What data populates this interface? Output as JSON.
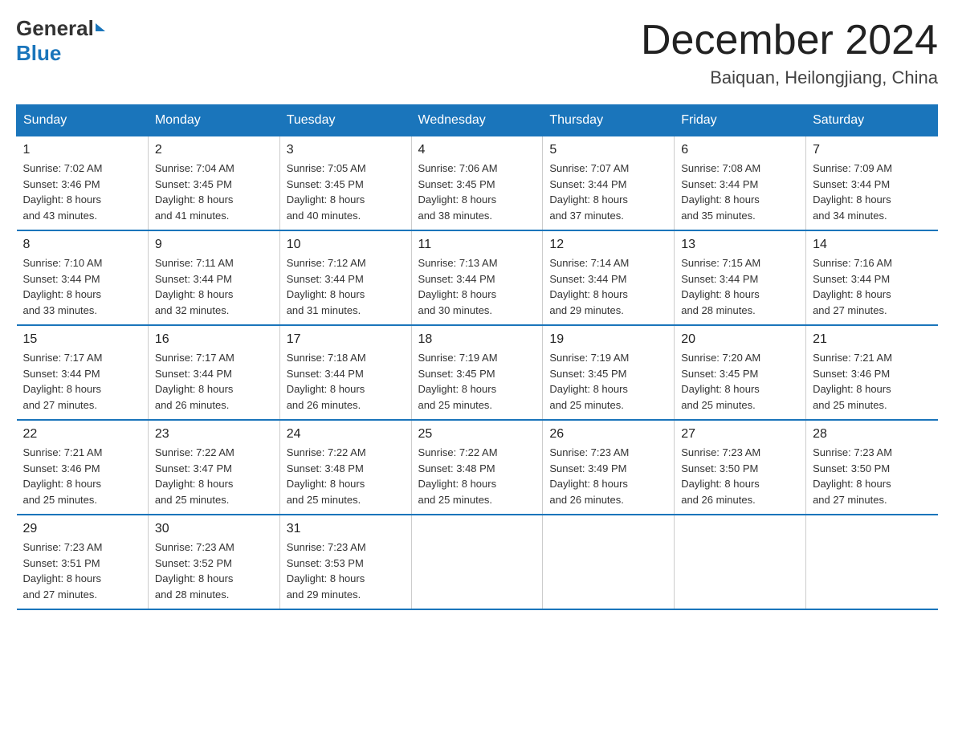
{
  "header": {
    "logo": {
      "general": "General",
      "blue": "Blue"
    },
    "title": "December 2024",
    "location": "Baiquan, Heilongjiang, China"
  },
  "days_of_week": [
    "Sunday",
    "Monday",
    "Tuesday",
    "Wednesday",
    "Thursday",
    "Friday",
    "Saturday"
  ],
  "weeks": [
    [
      {
        "day": "1",
        "sunrise": "7:02 AM",
        "sunset": "3:46 PM",
        "daylight": "8 hours and 43 minutes."
      },
      {
        "day": "2",
        "sunrise": "7:04 AM",
        "sunset": "3:45 PM",
        "daylight": "8 hours and 41 minutes."
      },
      {
        "day": "3",
        "sunrise": "7:05 AM",
        "sunset": "3:45 PM",
        "daylight": "8 hours and 40 minutes."
      },
      {
        "day": "4",
        "sunrise": "7:06 AM",
        "sunset": "3:45 PM",
        "daylight": "8 hours and 38 minutes."
      },
      {
        "day": "5",
        "sunrise": "7:07 AM",
        "sunset": "3:44 PM",
        "daylight": "8 hours and 37 minutes."
      },
      {
        "day": "6",
        "sunrise": "7:08 AM",
        "sunset": "3:44 PM",
        "daylight": "8 hours and 35 minutes."
      },
      {
        "day": "7",
        "sunrise": "7:09 AM",
        "sunset": "3:44 PM",
        "daylight": "8 hours and 34 minutes."
      }
    ],
    [
      {
        "day": "8",
        "sunrise": "7:10 AM",
        "sunset": "3:44 PM",
        "daylight": "8 hours and 33 minutes."
      },
      {
        "day": "9",
        "sunrise": "7:11 AM",
        "sunset": "3:44 PM",
        "daylight": "8 hours and 32 minutes."
      },
      {
        "day": "10",
        "sunrise": "7:12 AM",
        "sunset": "3:44 PM",
        "daylight": "8 hours and 31 minutes."
      },
      {
        "day": "11",
        "sunrise": "7:13 AM",
        "sunset": "3:44 PM",
        "daylight": "8 hours and 30 minutes."
      },
      {
        "day": "12",
        "sunrise": "7:14 AM",
        "sunset": "3:44 PM",
        "daylight": "8 hours and 29 minutes."
      },
      {
        "day": "13",
        "sunrise": "7:15 AM",
        "sunset": "3:44 PM",
        "daylight": "8 hours and 28 minutes."
      },
      {
        "day": "14",
        "sunrise": "7:16 AM",
        "sunset": "3:44 PM",
        "daylight": "8 hours and 27 minutes."
      }
    ],
    [
      {
        "day": "15",
        "sunrise": "7:17 AM",
        "sunset": "3:44 PM",
        "daylight": "8 hours and 27 minutes."
      },
      {
        "day": "16",
        "sunrise": "7:17 AM",
        "sunset": "3:44 PM",
        "daylight": "8 hours and 26 minutes."
      },
      {
        "day": "17",
        "sunrise": "7:18 AM",
        "sunset": "3:44 PM",
        "daylight": "8 hours and 26 minutes."
      },
      {
        "day": "18",
        "sunrise": "7:19 AM",
        "sunset": "3:45 PM",
        "daylight": "8 hours and 25 minutes."
      },
      {
        "day": "19",
        "sunrise": "7:19 AM",
        "sunset": "3:45 PM",
        "daylight": "8 hours and 25 minutes."
      },
      {
        "day": "20",
        "sunrise": "7:20 AM",
        "sunset": "3:45 PM",
        "daylight": "8 hours and 25 minutes."
      },
      {
        "day": "21",
        "sunrise": "7:21 AM",
        "sunset": "3:46 PM",
        "daylight": "8 hours and 25 minutes."
      }
    ],
    [
      {
        "day": "22",
        "sunrise": "7:21 AM",
        "sunset": "3:46 PM",
        "daylight": "8 hours and 25 minutes."
      },
      {
        "day": "23",
        "sunrise": "7:22 AM",
        "sunset": "3:47 PM",
        "daylight": "8 hours and 25 minutes."
      },
      {
        "day": "24",
        "sunrise": "7:22 AM",
        "sunset": "3:48 PM",
        "daylight": "8 hours and 25 minutes."
      },
      {
        "day": "25",
        "sunrise": "7:22 AM",
        "sunset": "3:48 PM",
        "daylight": "8 hours and 25 minutes."
      },
      {
        "day": "26",
        "sunrise": "7:23 AM",
        "sunset": "3:49 PM",
        "daylight": "8 hours and 26 minutes."
      },
      {
        "day": "27",
        "sunrise": "7:23 AM",
        "sunset": "3:50 PM",
        "daylight": "8 hours and 26 minutes."
      },
      {
        "day": "28",
        "sunrise": "7:23 AM",
        "sunset": "3:50 PM",
        "daylight": "8 hours and 27 minutes."
      }
    ],
    [
      {
        "day": "29",
        "sunrise": "7:23 AM",
        "sunset": "3:51 PM",
        "daylight": "8 hours and 27 minutes."
      },
      {
        "day": "30",
        "sunrise": "7:23 AM",
        "sunset": "3:52 PM",
        "daylight": "8 hours and 28 minutes."
      },
      {
        "day": "31",
        "sunrise": "7:23 AM",
        "sunset": "3:53 PM",
        "daylight": "8 hours and 29 minutes."
      },
      null,
      null,
      null,
      null
    ]
  ],
  "labels": {
    "sunrise": "Sunrise: ",
    "sunset": "Sunset: ",
    "daylight": "Daylight: "
  }
}
